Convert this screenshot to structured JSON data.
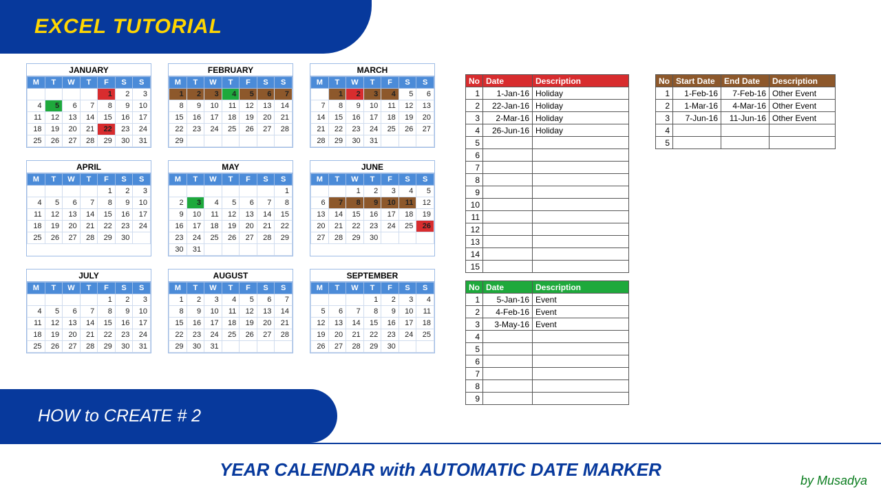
{
  "banners": {
    "top": "EXCEL TUTORIAL",
    "mid": "HOW to CREATE # 2",
    "bottom": "YEAR CALENDAR with AUTOMATIC DATE MARKER",
    "by": "by Musadya"
  },
  "dow": [
    "M",
    "T",
    "W",
    "T",
    "F",
    "S",
    "S"
  ],
  "months": [
    {
      "name": "JANUARY",
      "start": 4,
      "len": 31,
      "hl": {
        "1": "red",
        "5": "green",
        "22": "red"
      }
    },
    {
      "name": "FEBRUARY",
      "start": 0,
      "len": 29,
      "hl": {
        "1": "brown",
        "2": "brown",
        "3": "brown",
        "4": "green",
        "5": "brown",
        "6": "brown",
        "7": "brown"
      }
    },
    {
      "name": "MARCH",
      "start": 1,
      "len": 31,
      "hl": {
        "1": "brown",
        "2": "red",
        "3": "brown",
        "4": "brown"
      }
    },
    {
      "name": "APRIL",
      "start": 4,
      "len": 30,
      "hl": {}
    },
    {
      "name": "MAY",
      "start": 6,
      "len": 31,
      "hl": {
        "3": "green"
      }
    },
    {
      "name": "JUNE",
      "start": 2,
      "len": 30,
      "hl": {
        "7": "brown",
        "8": "brown",
        "9": "brown",
        "10": "brown",
        "11": "brown",
        "26": "red"
      }
    },
    {
      "name": "JULY",
      "start": 4,
      "len": 31,
      "hl": {}
    },
    {
      "name": "AUGUST",
      "start": 0,
      "len": 31,
      "hl": {}
    },
    {
      "name": "SEPTEMBER",
      "start": 3,
      "len": 30,
      "hl": {}
    }
  ],
  "holiday_table": {
    "headers": [
      "No",
      "Date",
      "Description"
    ],
    "rows": [
      [
        "1",
        "1-Jan-16",
        "Holiday"
      ],
      [
        "2",
        "22-Jan-16",
        "Holiday"
      ],
      [
        "3",
        "2-Mar-16",
        "Holiday"
      ],
      [
        "4",
        "26-Jun-16",
        "Holiday"
      ],
      [
        "5",
        "",
        ""
      ],
      [
        "6",
        "",
        ""
      ],
      [
        "7",
        "",
        ""
      ],
      [
        "8",
        "",
        ""
      ],
      [
        "9",
        "",
        ""
      ],
      [
        "10",
        "",
        ""
      ],
      [
        "11",
        "",
        ""
      ],
      [
        "12",
        "",
        ""
      ],
      [
        "13",
        "",
        ""
      ],
      [
        "14",
        "",
        ""
      ],
      [
        "15",
        "",
        ""
      ]
    ]
  },
  "event_table": {
    "headers": [
      "No",
      "Date",
      "Description"
    ],
    "rows": [
      [
        "1",
        "5-Jan-16",
        "Event"
      ],
      [
        "2",
        "4-Feb-16",
        "Event"
      ],
      [
        "3",
        "3-May-16",
        "Event"
      ],
      [
        "4",
        "",
        ""
      ],
      [
        "5",
        "",
        ""
      ],
      [
        "6",
        "",
        ""
      ],
      [
        "7",
        "",
        ""
      ],
      [
        "8",
        "",
        ""
      ],
      [
        "9",
        "",
        ""
      ]
    ]
  },
  "range_table": {
    "headers": [
      "No",
      "Start Date",
      "End Date",
      "Description"
    ],
    "rows": [
      [
        "1",
        "1-Feb-16",
        "7-Feb-16",
        "Other Event"
      ],
      [
        "2",
        "1-Mar-16",
        "4-Mar-16",
        "Other Event"
      ],
      [
        "3",
        "7-Jun-16",
        "11-Jun-16",
        "Other Event"
      ],
      [
        "4",
        "",
        "",
        ""
      ],
      [
        "5",
        "",
        "",
        ""
      ]
    ]
  }
}
